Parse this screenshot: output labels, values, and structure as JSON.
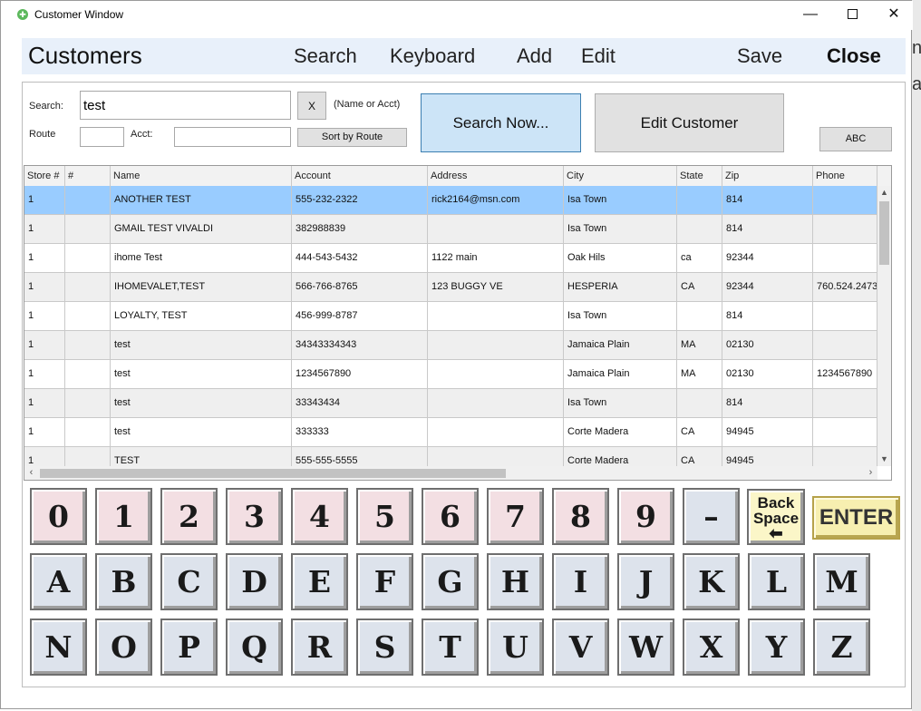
{
  "window": {
    "title": "Customer Window"
  },
  "background_fragments": [
    "n",
    "a"
  ],
  "menu": {
    "title": "Customers",
    "search": "Search",
    "keyboard": "Keyboard",
    "add": "Add",
    "edit": "Edit",
    "save": "Save",
    "close": "Close"
  },
  "search_panel": {
    "search_label": "Search:",
    "search_value": "test",
    "clear_label": "X",
    "hint": "(Name or Acct)",
    "route_label": "Route",
    "route_value": "",
    "acct_label": "Acct:",
    "acct_value": "",
    "sort_label": "Sort by Route",
    "search_now_label": "Search Now...",
    "edit_customer_label": "Edit Customer",
    "abc_label": "ABC"
  },
  "grid": {
    "columns": [
      "Store #",
      "#",
      "Name",
      "Account",
      "Address",
      "City",
      "State",
      "Zip",
      "Phone"
    ],
    "rows": [
      [
        "1",
        "",
        "ANOTHER TEST",
        "555-232-2322",
        "rick2164@msn.com",
        "Isa Town",
        "",
        "814",
        ""
      ],
      [
        "1",
        "",
        "GMAIL TEST VIVALDI",
        "382988839",
        "",
        "Isa Town",
        "",
        "814",
        ""
      ],
      [
        "1",
        "",
        "ihome Test",
        "444-543-5432",
        "1122 main",
        "Oak Hils",
        "ca",
        "92344",
        ""
      ],
      [
        "1",
        "",
        "IHOMEVALET,TEST",
        "566-766-8765",
        "123 BUGGY VE",
        "HESPERIA",
        "CA",
        "92344",
        "760.524.2473"
      ],
      [
        "1",
        "",
        "LOYALTY, TEST",
        "456-999-8787",
        "",
        "Isa Town",
        "",
        "814",
        ""
      ],
      [
        "1",
        "",
        "test",
        "34343334343",
        "",
        "Jamaica Plain",
        "MA",
        "02130",
        ""
      ],
      [
        "1",
        "",
        "test",
        "1234567890",
        "",
        "Jamaica Plain",
        "MA",
        "02130",
        "1234567890"
      ],
      [
        "1",
        "",
        "test",
        "33343434",
        "",
        "Isa Town",
        "",
        "814",
        ""
      ],
      [
        "1",
        "",
        "test",
        "333333",
        "",
        "Corte Madera",
        "CA",
        "94945",
        ""
      ],
      [
        "1",
        "",
        "TEST",
        "555-555-5555",
        "",
        "Corte Madera",
        "CA",
        "94945",
        ""
      ]
    ],
    "selected_row": 0
  },
  "keyboard": {
    "number_row": [
      "0",
      "1",
      "2",
      "3",
      "4",
      "5",
      "6",
      "7",
      "8",
      "9",
      "–"
    ],
    "row2": [
      "A",
      "B",
      "C",
      "D",
      "E",
      "F",
      "G",
      "H",
      "I",
      "J",
      "K",
      "L",
      "M"
    ],
    "row3": [
      "N",
      "O",
      "P",
      "Q",
      "R",
      "S",
      "T",
      "U",
      "V",
      "W",
      "X",
      "Y",
      "Z"
    ],
    "backspace_line1": "Back",
    "backspace_line2": "Space",
    "enter_label": "ENTER"
  },
  "colors": {
    "selected_row": "#99ccff",
    "number_key": "#f3dfe3",
    "letter_key": "#dde3ec",
    "primary_button": "#cce4f7"
  }
}
